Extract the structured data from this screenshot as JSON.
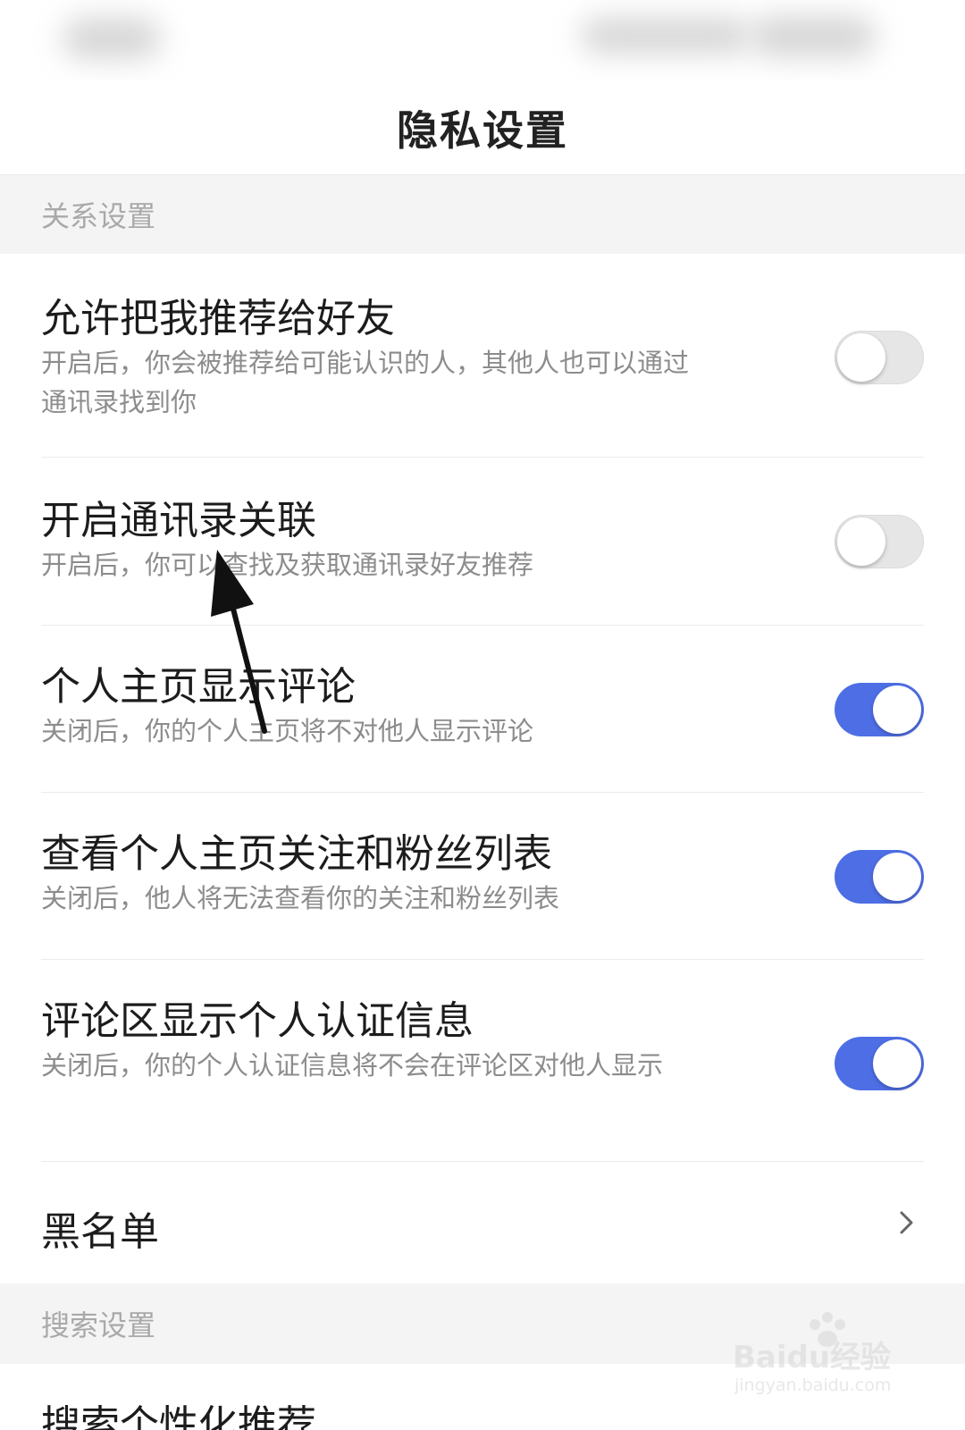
{
  "header": {
    "title": "隐私设置"
  },
  "sections": {
    "relationship": {
      "title": "关系设置"
    },
    "search": {
      "title": "搜索设置"
    }
  },
  "settings": [
    {
      "title": "允许把我推荐给好友",
      "description": "开启后，你会被推荐给可能认识的人，其他人也可以通过通讯录找到你",
      "enabled": false
    },
    {
      "title": "开启通讯录关联",
      "description": "开启后，你可以查找及获取通讯录好友推荐",
      "enabled": false
    },
    {
      "title": "个人主页显示评论",
      "description": "关闭后，你的个人主页将不对他人显示评论",
      "enabled": true
    },
    {
      "title": "查看个人主页关注和粉丝列表",
      "description": "关闭后，他人将无法查看你的关注和粉丝列表",
      "enabled": true
    },
    {
      "title": "评论区显示个人认证信息",
      "description": "关闭后，你的个人认证信息将不会在评论区对他人显示",
      "enabled": true
    }
  ],
  "blacklist": {
    "title": "黑名单"
  },
  "search_settings": {
    "first_item": "搜索个性化推荐"
  },
  "colors": {
    "toggle_on": "#4e6ee6",
    "toggle_off": "#e6e6e6"
  },
  "watermark": {
    "brand": "Baidu经验",
    "url": "jingyan.baidu.com"
  },
  "icons": {
    "blacklist_chevron": "chevron-right-icon"
  }
}
